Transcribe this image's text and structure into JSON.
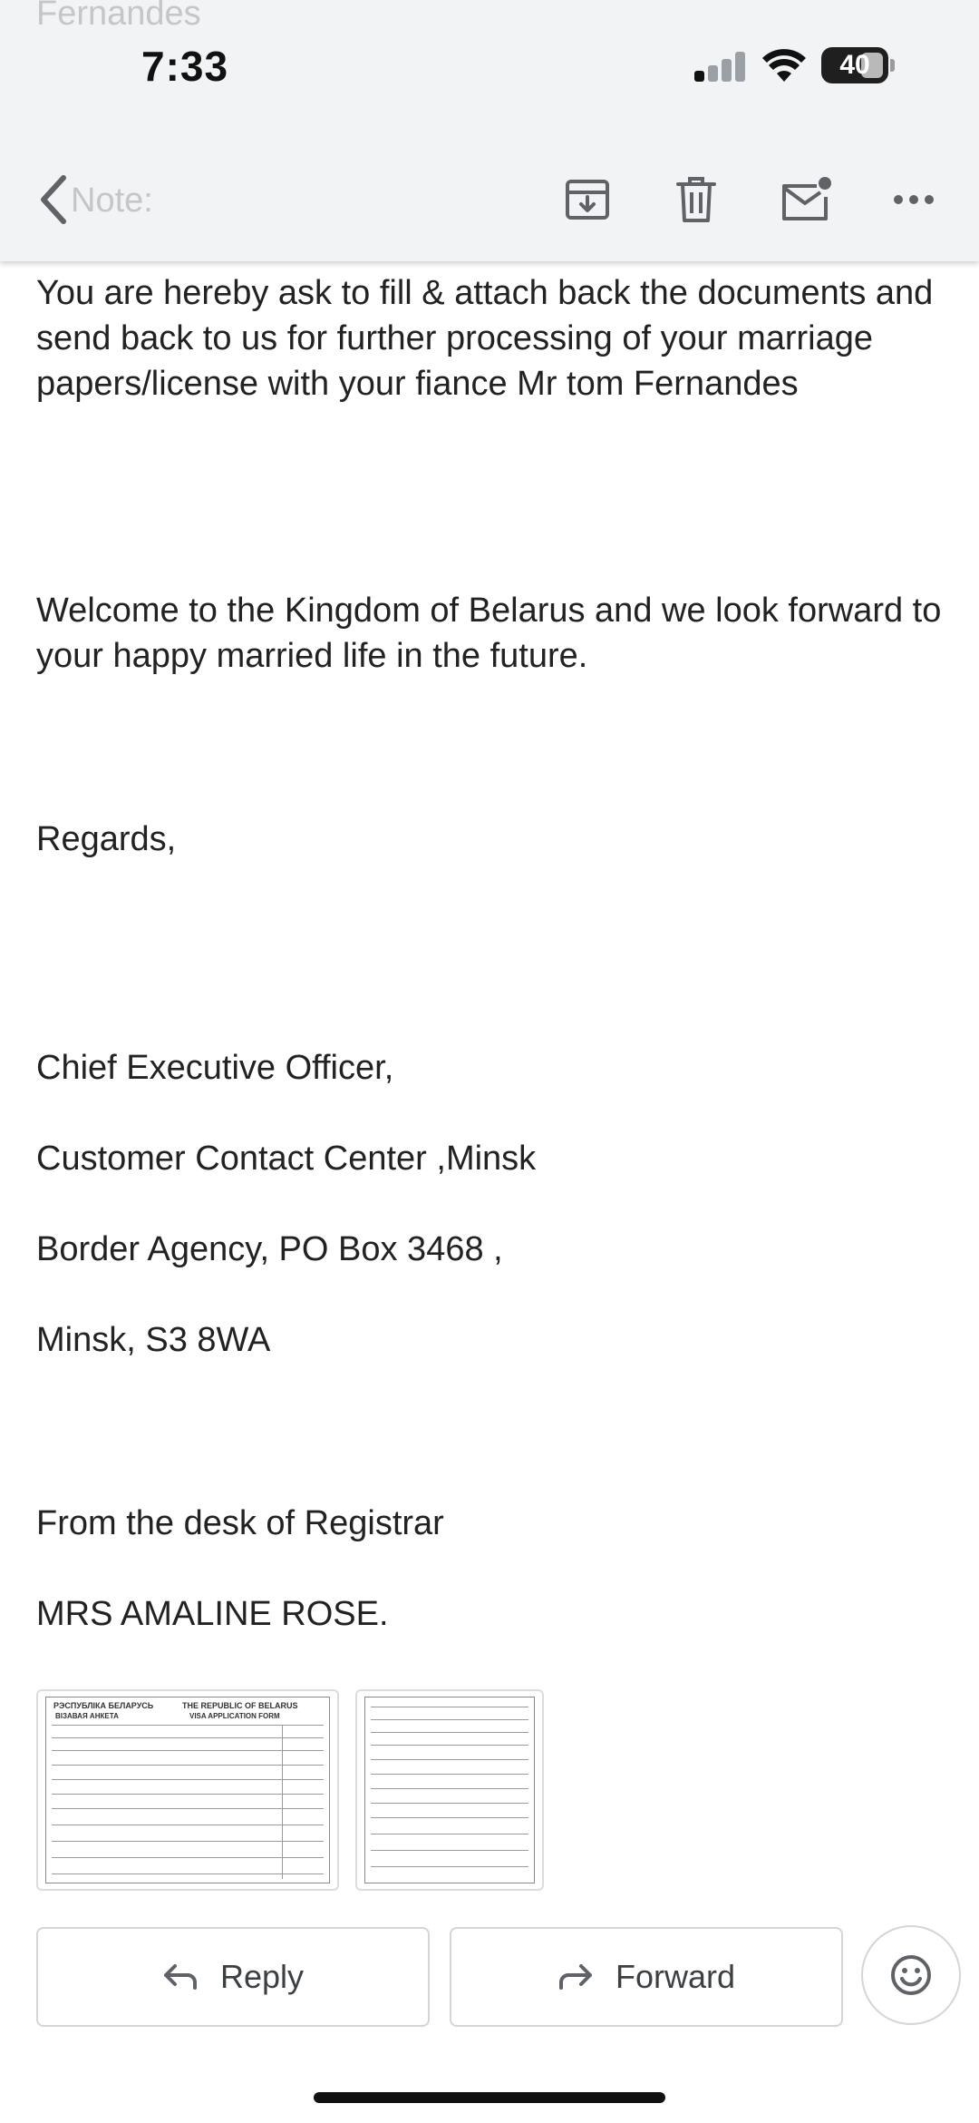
{
  "status_bar": {
    "time": "7:33",
    "battery": "40"
  },
  "ghost_text": {
    "top": "Fernandes",
    "mid": "Note:"
  },
  "toolbar": {
    "back_icon": "chevron-left-icon",
    "archive_icon": "archive-icon",
    "delete_icon": "trash-icon",
    "unread_icon": "mail-unread-icon",
    "more_icon": "more-horizontal-icon"
  },
  "email": {
    "para1": "You are hereby ask to fill & attach back the documents and send back to us for further processing of your marriage papers/license with your fiance Mr tom Fernandes",
    "para2": "Welcome to the Kingdom of Belarus and we look forward to your happy married life in the future.",
    "regards": "Regards,",
    "sig1": "Chief Executive Officer,",
    "sig2": "Customer Contact Center ,Minsk",
    "sig3": "Border Agency, PO Box 3468 ,",
    "sig4": "Minsk, S3 8WA",
    "from": "From the desk of Registrar",
    "name": "MRS AMALINE ROSE."
  },
  "attachments": [
    {
      "header_left": "РЭСПУБЛІКА БЕЛАРУСЬ",
      "header_right": "THE REPUBLIC OF BELARUS",
      "sub_left": "ВІЗАВАЯ АНКЕТА",
      "sub_right": "VISA APPLICATION FORM"
    },
    {
      "header_left": "",
      "header_right": "",
      "sub_left": "",
      "sub_right": ""
    }
  ],
  "actions": {
    "reply": "Reply",
    "forward": "Forward"
  }
}
